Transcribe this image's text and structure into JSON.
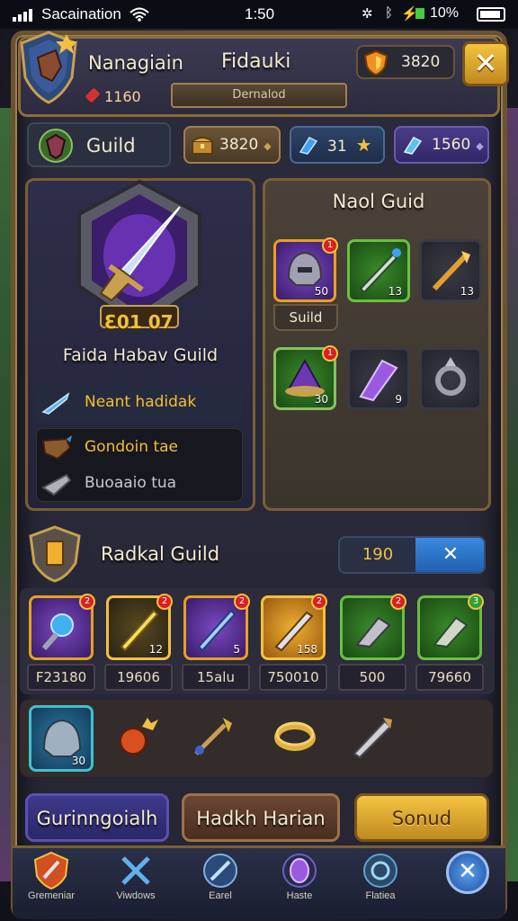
{
  "status_bar": {
    "carrier": "Sacaination",
    "time": "1:50",
    "battery": "10%"
  },
  "header": {
    "name": "Nanagiain",
    "title": "Fidauki",
    "gems": "1160",
    "banner": "Dernalod",
    "gold": "3820",
    "close_glyph": "✕"
  },
  "tabs": {
    "guild_label": "Guild"
  },
  "resources": [
    {
      "value": "3820",
      "icon": "treasure-chest-icon"
    },
    {
      "value": "31",
      "icon": "crystal-shard-icon"
    },
    {
      "value": "1560",
      "icon": "blue-gem-icon"
    }
  ],
  "guild_panel": {
    "emblem_level": "Ɛ01 07",
    "name": "Faida Habav Guild",
    "rows": [
      "Neant hadidak",
      "Gondoin tae",
      "Buoaaio tua"
    ]
  },
  "right_panel": {
    "title": "Naol Guid",
    "slots": [
      {
        "count": "50",
        "badge": "1"
      },
      {
        "count": "13",
        "badge": ""
      },
      {
        "count": "13",
        "badge": ""
      },
      {
        "count": "30",
        "badge": "1"
      },
      {
        "count": "9",
        "badge": ""
      },
      {
        "count": "",
        "badge": ""
      }
    ],
    "slot_label": "Suild"
  },
  "radkal": {
    "title": "Radkal Guild",
    "toggle_value": "190",
    "toggle_glyph": "✕"
  },
  "items": [
    {
      "price": "F23180",
      "count": "",
      "badge": "2"
    },
    {
      "price": "19606",
      "count": "12",
      "badge": "2"
    },
    {
      "price": "15alu",
      "count": "5",
      "badge": "2"
    },
    {
      "price": "750010",
      "count": "158",
      "badge": "2"
    },
    {
      "price": "500",
      "count": "",
      "badge": "2"
    },
    {
      "price": "79660",
      "count": "",
      "badge": "3"
    }
  ],
  "loot": {
    "slot_count": "30"
  },
  "buttons": {
    "left": "Gurinngoialh",
    "middle": "Hadkh Harian",
    "right": "Sonud"
  },
  "nav": [
    {
      "label": "Gremeniar",
      "icon": "shield-sword-icon"
    },
    {
      "label": "Viwdows",
      "icon": "crossed-swords-icon"
    },
    {
      "label": "Earel",
      "icon": "globe-sword-icon"
    },
    {
      "label": "Haste",
      "icon": "purple-gem-icon"
    },
    {
      "label": "Flatiea",
      "icon": "rune-icon"
    }
  ],
  "nav_close_glyph": "✕"
}
